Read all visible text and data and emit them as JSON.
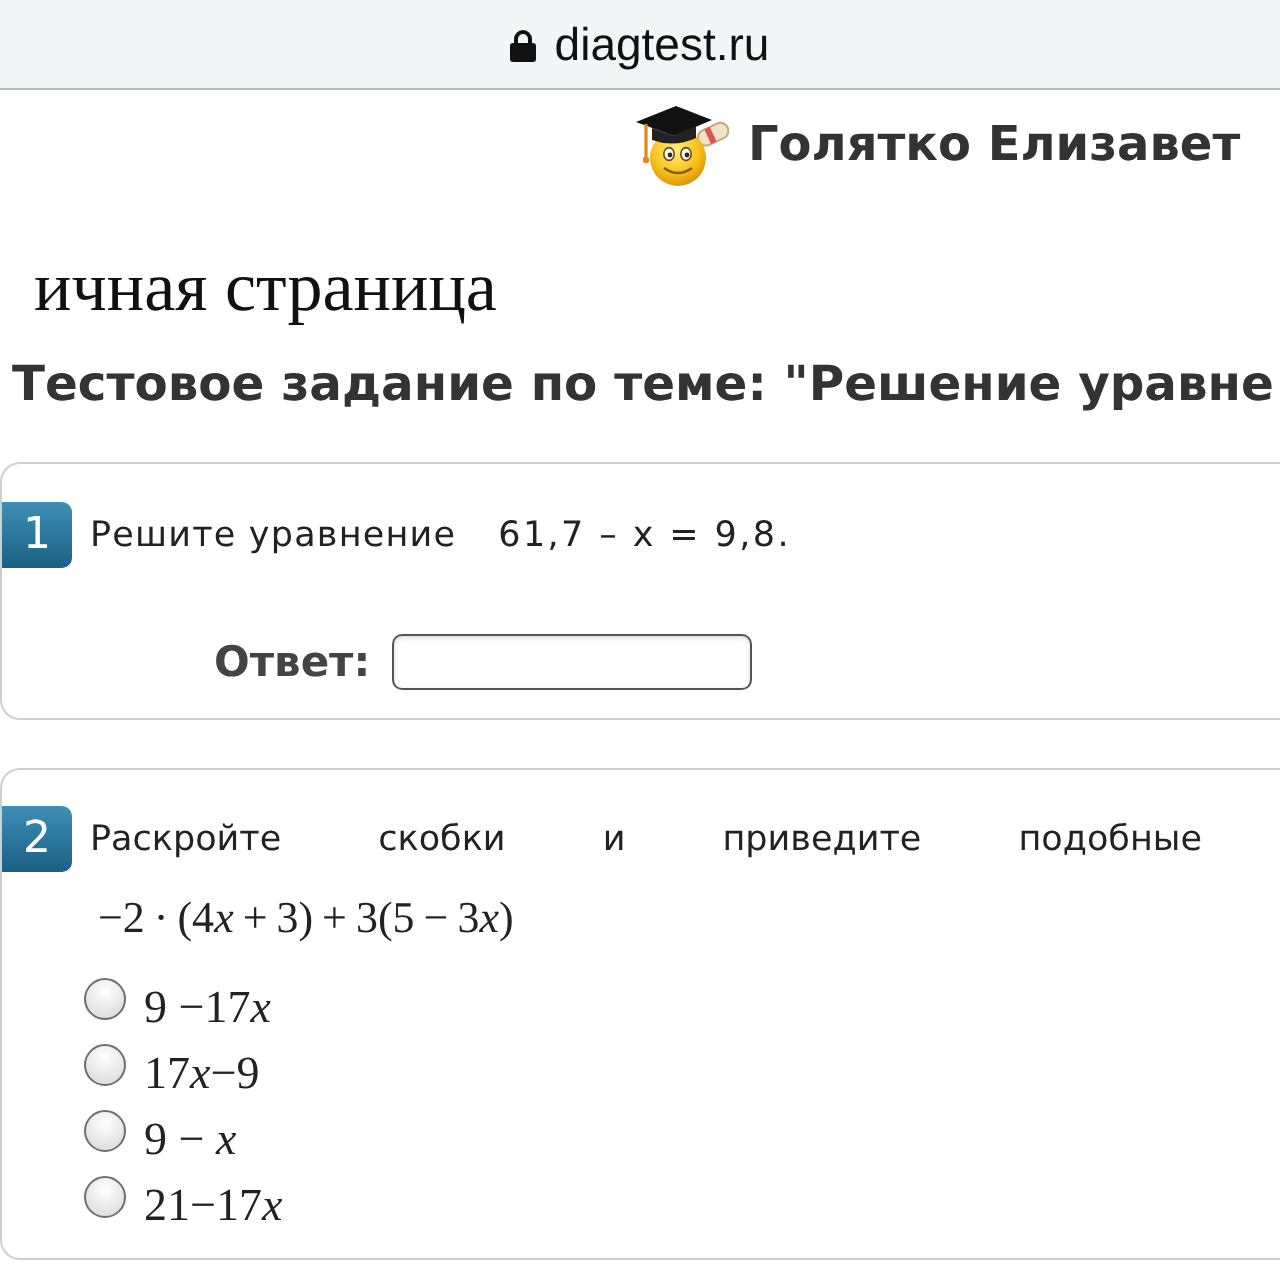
{
  "browser": {
    "url": "diagtest.ru"
  },
  "user": {
    "name": "Голятко Елизавет"
  },
  "page_title": "ичная страница",
  "test_title": "Тестовое задание по теме: \"Решение уравне",
  "questions": [
    {
      "kind": "input",
      "number": "1",
      "text": "Решите уравнение",
      "equation": "61,7 – x = 9,8.",
      "answer": {
        "label": "Ответ:"
      }
    },
    {
      "kind": "choice",
      "number": "2",
      "text": "Раскройте скобки и приведите подобные",
      "expression": [
        {
          "text": "−2 · (4",
          "italic": false
        },
        {
          "text": "x",
          "italic": true
        },
        {
          "text": " + 3) + 3(5 − 3",
          "italic": false
        },
        {
          "text": "x",
          "italic": true
        },
        {
          "text": ")",
          "italic": false
        }
      ],
      "options": [
        {
          "parts": [
            {
              "text": "9 −17",
              "italic": false
            },
            {
              "text": "x",
              "italic": true
            }
          ],
          "selected": false
        },
        {
          "parts": [
            {
              "text": "17",
              "italic": false
            },
            {
              "text": "x",
              "italic": true
            },
            {
              "text": "−9",
              "italic": false
            }
          ],
          "selected": false
        },
        {
          "parts": [
            {
              "text": "9 − ",
              "italic": false
            },
            {
              "text": "x",
              "italic": true
            }
          ],
          "selected": false
        },
        {
          "parts": [
            {
              "text": "21−17",
              "italic": false
            },
            {
              "text": "x",
              "italic": true
            }
          ],
          "selected": false
        }
      ]
    }
  ]
}
